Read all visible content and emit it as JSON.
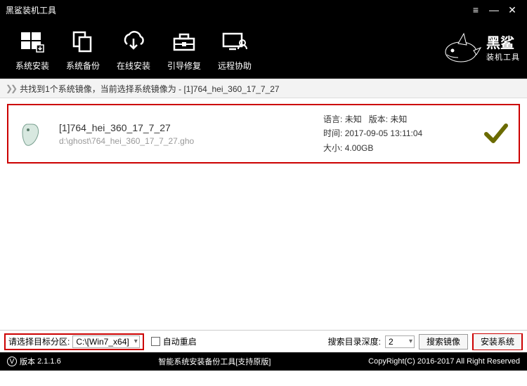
{
  "window": {
    "title": "黑鲨装机工具"
  },
  "toolbar": {
    "items": [
      {
        "label": "系统安装"
      },
      {
        "label": "系统备份"
      },
      {
        "label": "在线安装"
      },
      {
        "label": "引导修复"
      },
      {
        "label": "远程协助"
      }
    ]
  },
  "brand": {
    "name": "黑鲨",
    "sub": "装机工具"
  },
  "status": {
    "text": "共找到1个系统镜像，当前选择系统镜像为 - [1]764_hei_360_17_7_27"
  },
  "image_item": {
    "title": "[1]764_hei_360_17_7_27",
    "path": "d:\\ghost\\764_hei_360_17_7_27.gho",
    "lang_label": "语言:",
    "lang_value": "未知",
    "ver_label": "版本:",
    "ver_value": "未知",
    "time_label": "时间:",
    "time_value": "2017-09-05 13:11:04",
    "size_label": "大小:",
    "size_value": "4.00GB",
    "selected": true
  },
  "bottom": {
    "partition_label": "请选择目标分区:",
    "partition_value": "C:\\[Win7_x64]",
    "auto_restart": "自动重启",
    "depth_label": "搜索目录深度:",
    "depth_value": "2",
    "search_btn": "搜索镜像",
    "install_btn": "安装系统"
  },
  "footer": {
    "version_label": "版本",
    "version": "2.1.1.6",
    "center": "智能系统安装备份工具[支持原版]",
    "copyright": "CopyRight(C) 2016-2017 All Right Reserved"
  }
}
